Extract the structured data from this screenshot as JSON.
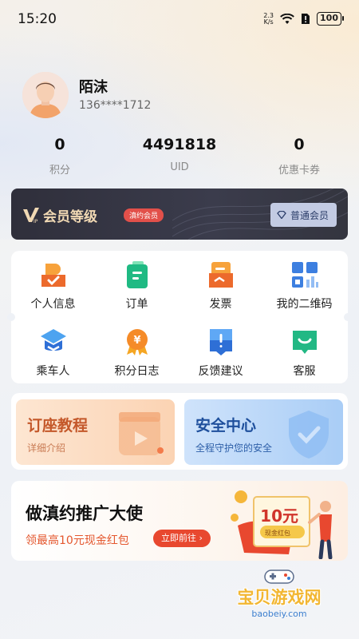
{
  "status_bar": {
    "time": "15:20",
    "net_speed_top": "2.3",
    "net_speed_bottom": "K/s",
    "battery": "100"
  },
  "profile": {
    "name": "陌沫",
    "phone": "136****1712"
  },
  "stats": [
    {
      "value": "0",
      "label": "积分"
    },
    {
      "value": "4491818",
      "label": "UID"
    },
    {
      "value": "0",
      "label": "优惠卡券"
    }
  ],
  "membership": {
    "title": "会员等级",
    "tag": "滇约会员",
    "level": "普通会员"
  },
  "services": [
    {
      "label": "个人信息",
      "icon": "profile-icon"
    },
    {
      "label": "订单",
      "icon": "order-icon"
    },
    {
      "label": "发票",
      "icon": "invoice-icon"
    },
    {
      "label": "我的二维码",
      "icon": "qr-code-icon"
    },
    {
      "label": "乘车人",
      "icon": "passenger-icon"
    },
    {
      "label": "积分日志",
      "icon": "points-log-icon"
    },
    {
      "label": "反馈建议",
      "icon": "feedback-icon"
    },
    {
      "label": "客服",
      "icon": "customer-service-icon"
    }
  ],
  "promos": {
    "tutorial": {
      "title": "订座教程",
      "subtitle": "详细介绍"
    },
    "security": {
      "title": "安全中心",
      "subtitle": "全程守护您的安全"
    }
  },
  "ambassador": {
    "title": "做滇约推广大使",
    "subtitle": "领最高10元现金红包",
    "button": "立即前往 ›",
    "voucher_amount": "10元",
    "voucher_label": "现金红包"
  },
  "watermark": {
    "text": "宝贝游戏网",
    "url": "baobeiy.com"
  },
  "colors": {
    "accent_red": "#e8482f",
    "member_gold": "#f1d9b4",
    "member_bg": "#2f2f3b"
  }
}
